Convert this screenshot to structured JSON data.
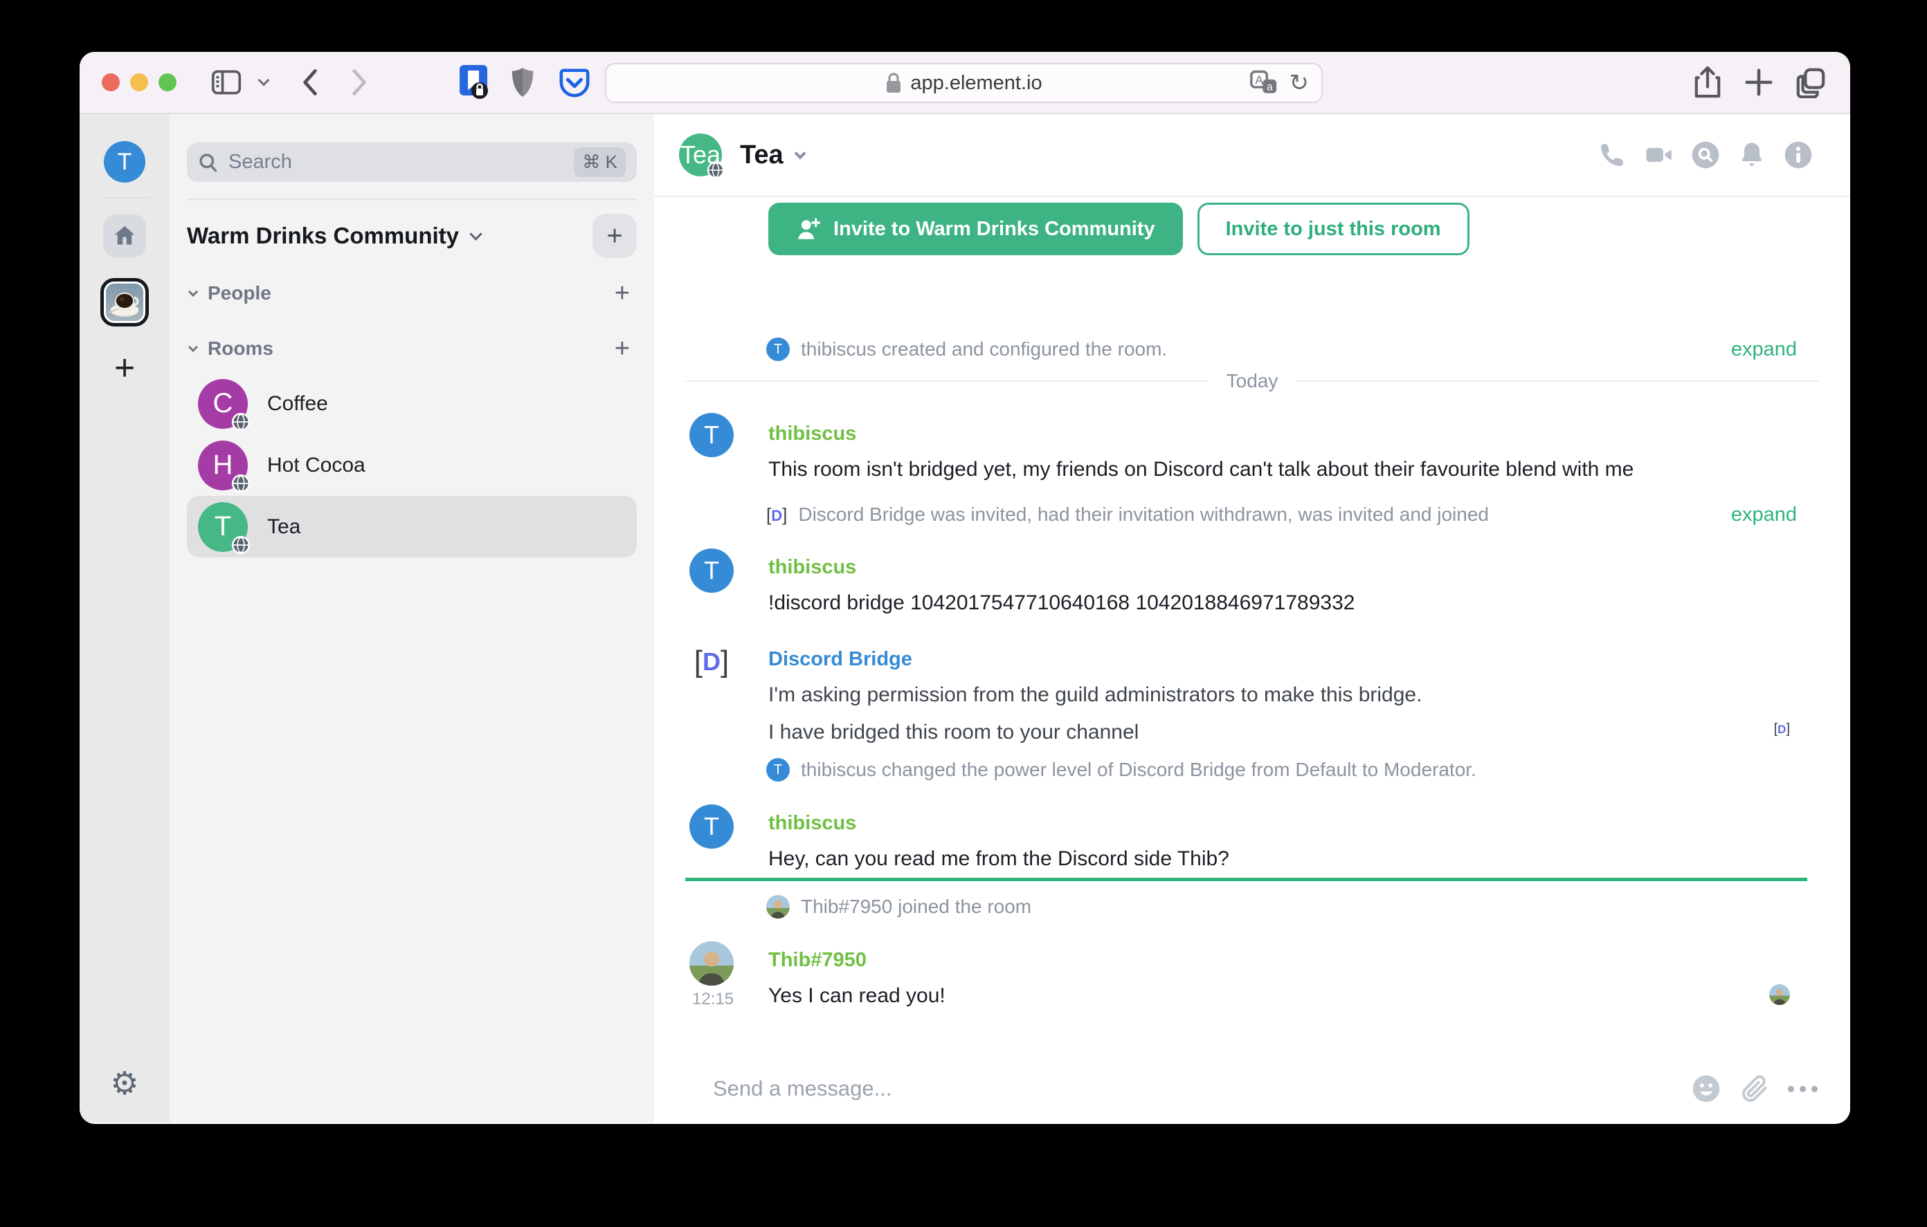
{
  "browser": {
    "url": "app.element.io"
  },
  "glyphs": {
    "plus": "+",
    "reload": "↻",
    "gear": "⚙",
    "bracket_left": "[",
    "bracket_right": "]"
  },
  "rail": {
    "user_initial": "T"
  },
  "sidebar": {
    "search": {
      "placeholder": "Search",
      "shortcut": "⌘ K"
    },
    "community": {
      "name": "Warm Drinks Community"
    },
    "sections": [
      {
        "label": "People"
      },
      {
        "label": "Rooms"
      }
    ],
    "rooms": [
      {
        "name": "Coffee",
        "initial": "C"
      },
      {
        "name": "Hot Cocoa",
        "initial": "H"
      },
      {
        "name": "Tea",
        "initial": "T",
        "selected": true
      }
    ]
  },
  "chat": {
    "header": {
      "room_name": "Tea"
    },
    "invite_banner": {
      "primary_label": "Invite to Warm Drinks Community",
      "secondary_label": "Invite to just this room"
    },
    "timeline": {
      "created_event": {
        "avatar_initial": "T",
        "text": "thibiscus created and configured the room.",
        "action": "expand"
      },
      "date_divider": "Today",
      "msg1": {
        "sender": "thibiscus",
        "avatar_initial": "T",
        "text": "This room isn't bridged yet, my friends on Discord can't talk about their favourite blend with me"
      },
      "bridge_event": {
        "bridge_initial": "D",
        "text": "Discord Bridge was invited, had their invitation withdrawn, was invited and joined",
        "action": "expand"
      },
      "msg2": {
        "sender": "thibiscus",
        "avatar_initial": "T",
        "text": "!discord bridge 1042017547710640168 1042018846971789332"
      },
      "msg3": {
        "sender": "Discord Bridge",
        "bridge_initial": "D",
        "line1": "I'm asking permission from the guild administrators to make this bridge.",
        "line2": "I have bridged this room to your channel"
      },
      "power_event": {
        "avatar_initial": "T",
        "text": "thibiscus changed the power level of Discord Bridge from Default to Moderator."
      },
      "msg4": {
        "sender": "thibiscus",
        "avatar_initial": "T",
        "text": "Hey, can you read me from the Discord side Thib?"
      },
      "joined_event": {
        "text": "Thib#7950 joined the room"
      },
      "msg5": {
        "sender": "Thib#7950",
        "time": "12:15",
        "text": "Yes I can read you!"
      }
    },
    "composer": {
      "placeholder": "Send a message..."
    }
  },
  "colors": {
    "accent": "#2eb37c",
    "invite_green": "#3eb485",
    "username_green": "#70c043",
    "user_blue": "#368bd6",
    "discord_blurple": "#5f6bea",
    "tea_green": "#45b885",
    "room_purple": "#a53ba5"
  }
}
